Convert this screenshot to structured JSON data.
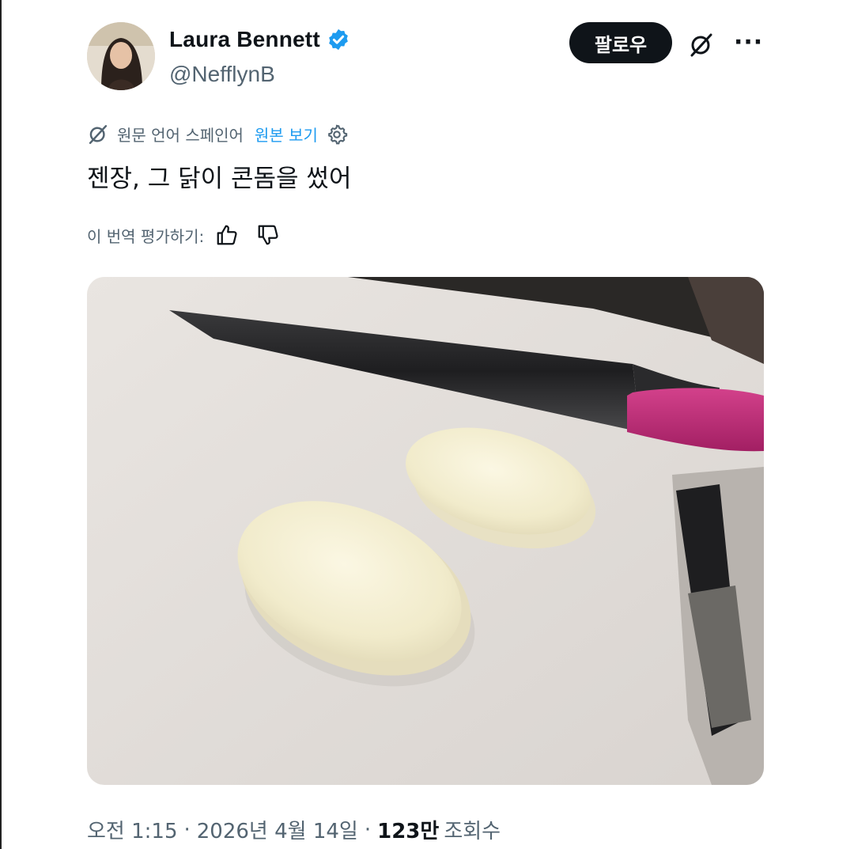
{
  "tweet": {
    "author": {
      "display_name": "Laura Bennett",
      "handle": "@NefflynB",
      "verified": true
    },
    "follow_label": "팔로우",
    "translation": {
      "language_note": "원문 언어 스페인어",
      "show_original": "원본 보기",
      "rate_label": "이 번역 평가하기:"
    },
    "text": "젠장, 그 닭이 콘돔을 썼어",
    "meta": {
      "time": "오전 1:15",
      "date": "2026년 4월 14일",
      "views_count": "123만",
      "views_label": "조회수",
      "separator": "·"
    }
  },
  "icons": {
    "verified": "verified-badge-icon",
    "grok": "grok-icon",
    "more": "more-icon",
    "translate": "translate-icon",
    "settings": "gear-icon",
    "thumbs_up": "thumbs-up-icon",
    "thumbs_down": "thumbs-down-icon"
  },
  "colors": {
    "text_primary": "#0f1419",
    "text_secondary": "#536471",
    "accent": "#1d9bf0",
    "follow_bg": "#0f1419"
  }
}
